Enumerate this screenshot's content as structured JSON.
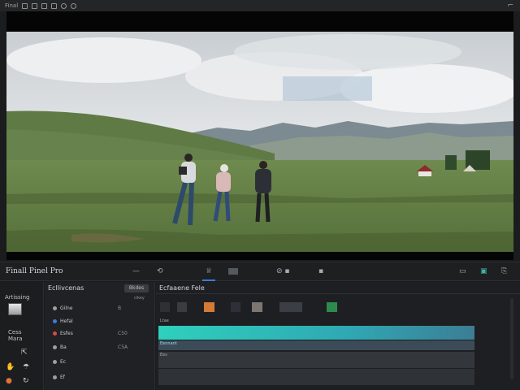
{
  "topbar": {
    "menu_label": "Final",
    "icons": [
      "file-icon",
      "grid-icon",
      "stack-icon",
      "layers-icon",
      "circle-icon",
      "loop-icon"
    ],
    "close_glyph": "⌐"
  },
  "toolbar": {
    "app_title": "Finall Pinel Pro",
    "glyph_minus": "—",
    "glyph_share": "⟲",
    "glyph_crown": "♕",
    "label_grid": "",
    "label_tools": "⊘ ▪",
    "label_clip": "▪",
    "glyph_folder": "▭",
    "glyph_save": "▣",
    "glyph_export": "⎘"
  },
  "left_tools": {
    "title": "Artissing",
    "media_label": "Cess",
    "media_sub": "Mara",
    "icon_pointer": "⇱",
    "icon_hand": "✋",
    "icon_brush": "☂",
    "icon_color": "●",
    "icon_loop": "↻"
  },
  "browser": {
    "title": "Ecllivcenas",
    "button_label": "Bkdes",
    "subtitle": "cikey",
    "rows": [
      {
        "name": "Gilne",
        "value": "B",
        "color": "#9aa0a6"
      },
      {
        "name": "Hefal",
        "value": "",
        "color": "#3f7be0"
      },
      {
        "name": "Esfes",
        "value": "C50",
        "color": "#d84a4a"
      },
      {
        "name": "Ba",
        "value": "C5A",
        "color": "#9aa0a6"
      },
      {
        "name": "Ec",
        "value": "",
        "color": "#9aa0a6"
      },
      {
        "name": "Ef",
        "value": "",
        "color": "#9aa0a6"
      }
    ]
  },
  "timeline": {
    "title": "Ecfaaene Fele",
    "track_labels": [
      "Ltae",
      "Eennant",
      "Ees"
    ],
    "colors": {
      "clip_main": "#2fd0bd",
      "clip_main_end": "#3c7d94",
      "track_two": "#3b4b58",
      "track_three": "#33363b",
      "thumb_orange": "#d47a35",
      "thumb_green": "#2f8a4e"
    }
  }
}
